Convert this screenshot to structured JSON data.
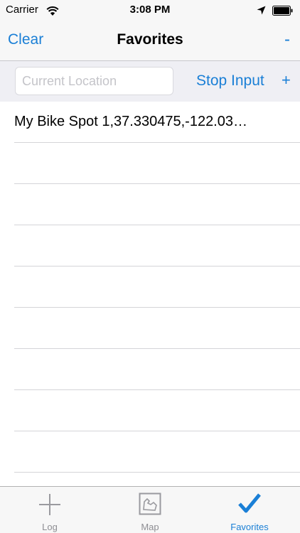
{
  "status_bar": {
    "carrier": "Carrier",
    "time": "3:08 PM",
    "icons": [
      "wifi-icon",
      "location-arrow-icon",
      "battery-icon"
    ]
  },
  "nav": {
    "clear_label": "Clear",
    "title": "Favorites",
    "minus_label": "-"
  },
  "input_bar": {
    "placeholder": "Current Location",
    "value": "",
    "stop_label": "Stop Input",
    "plus_label": "+"
  },
  "favorites": {
    "items": [
      {
        "text": "My Bike Spot 1,37.330475,-122.03…"
      },
      {
        "text": ""
      },
      {
        "text": ""
      },
      {
        "text": ""
      },
      {
        "text": ""
      },
      {
        "text": ""
      },
      {
        "text": ""
      },
      {
        "text": ""
      },
      {
        "text": ""
      }
    ]
  },
  "tabs": [
    {
      "label": "Log",
      "icon": "plus-icon",
      "active": false
    },
    {
      "label": "Map",
      "icon": "map-icon",
      "active": false
    },
    {
      "label": "Favorites",
      "icon": "checkmark-icon",
      "active": true
    }
  ],
  "colors": {
    "accent": "#1a7fd6",
    "inactive_tab": "#8e8e93",
    "bar_background": "#f7f7f7"
  }
}
